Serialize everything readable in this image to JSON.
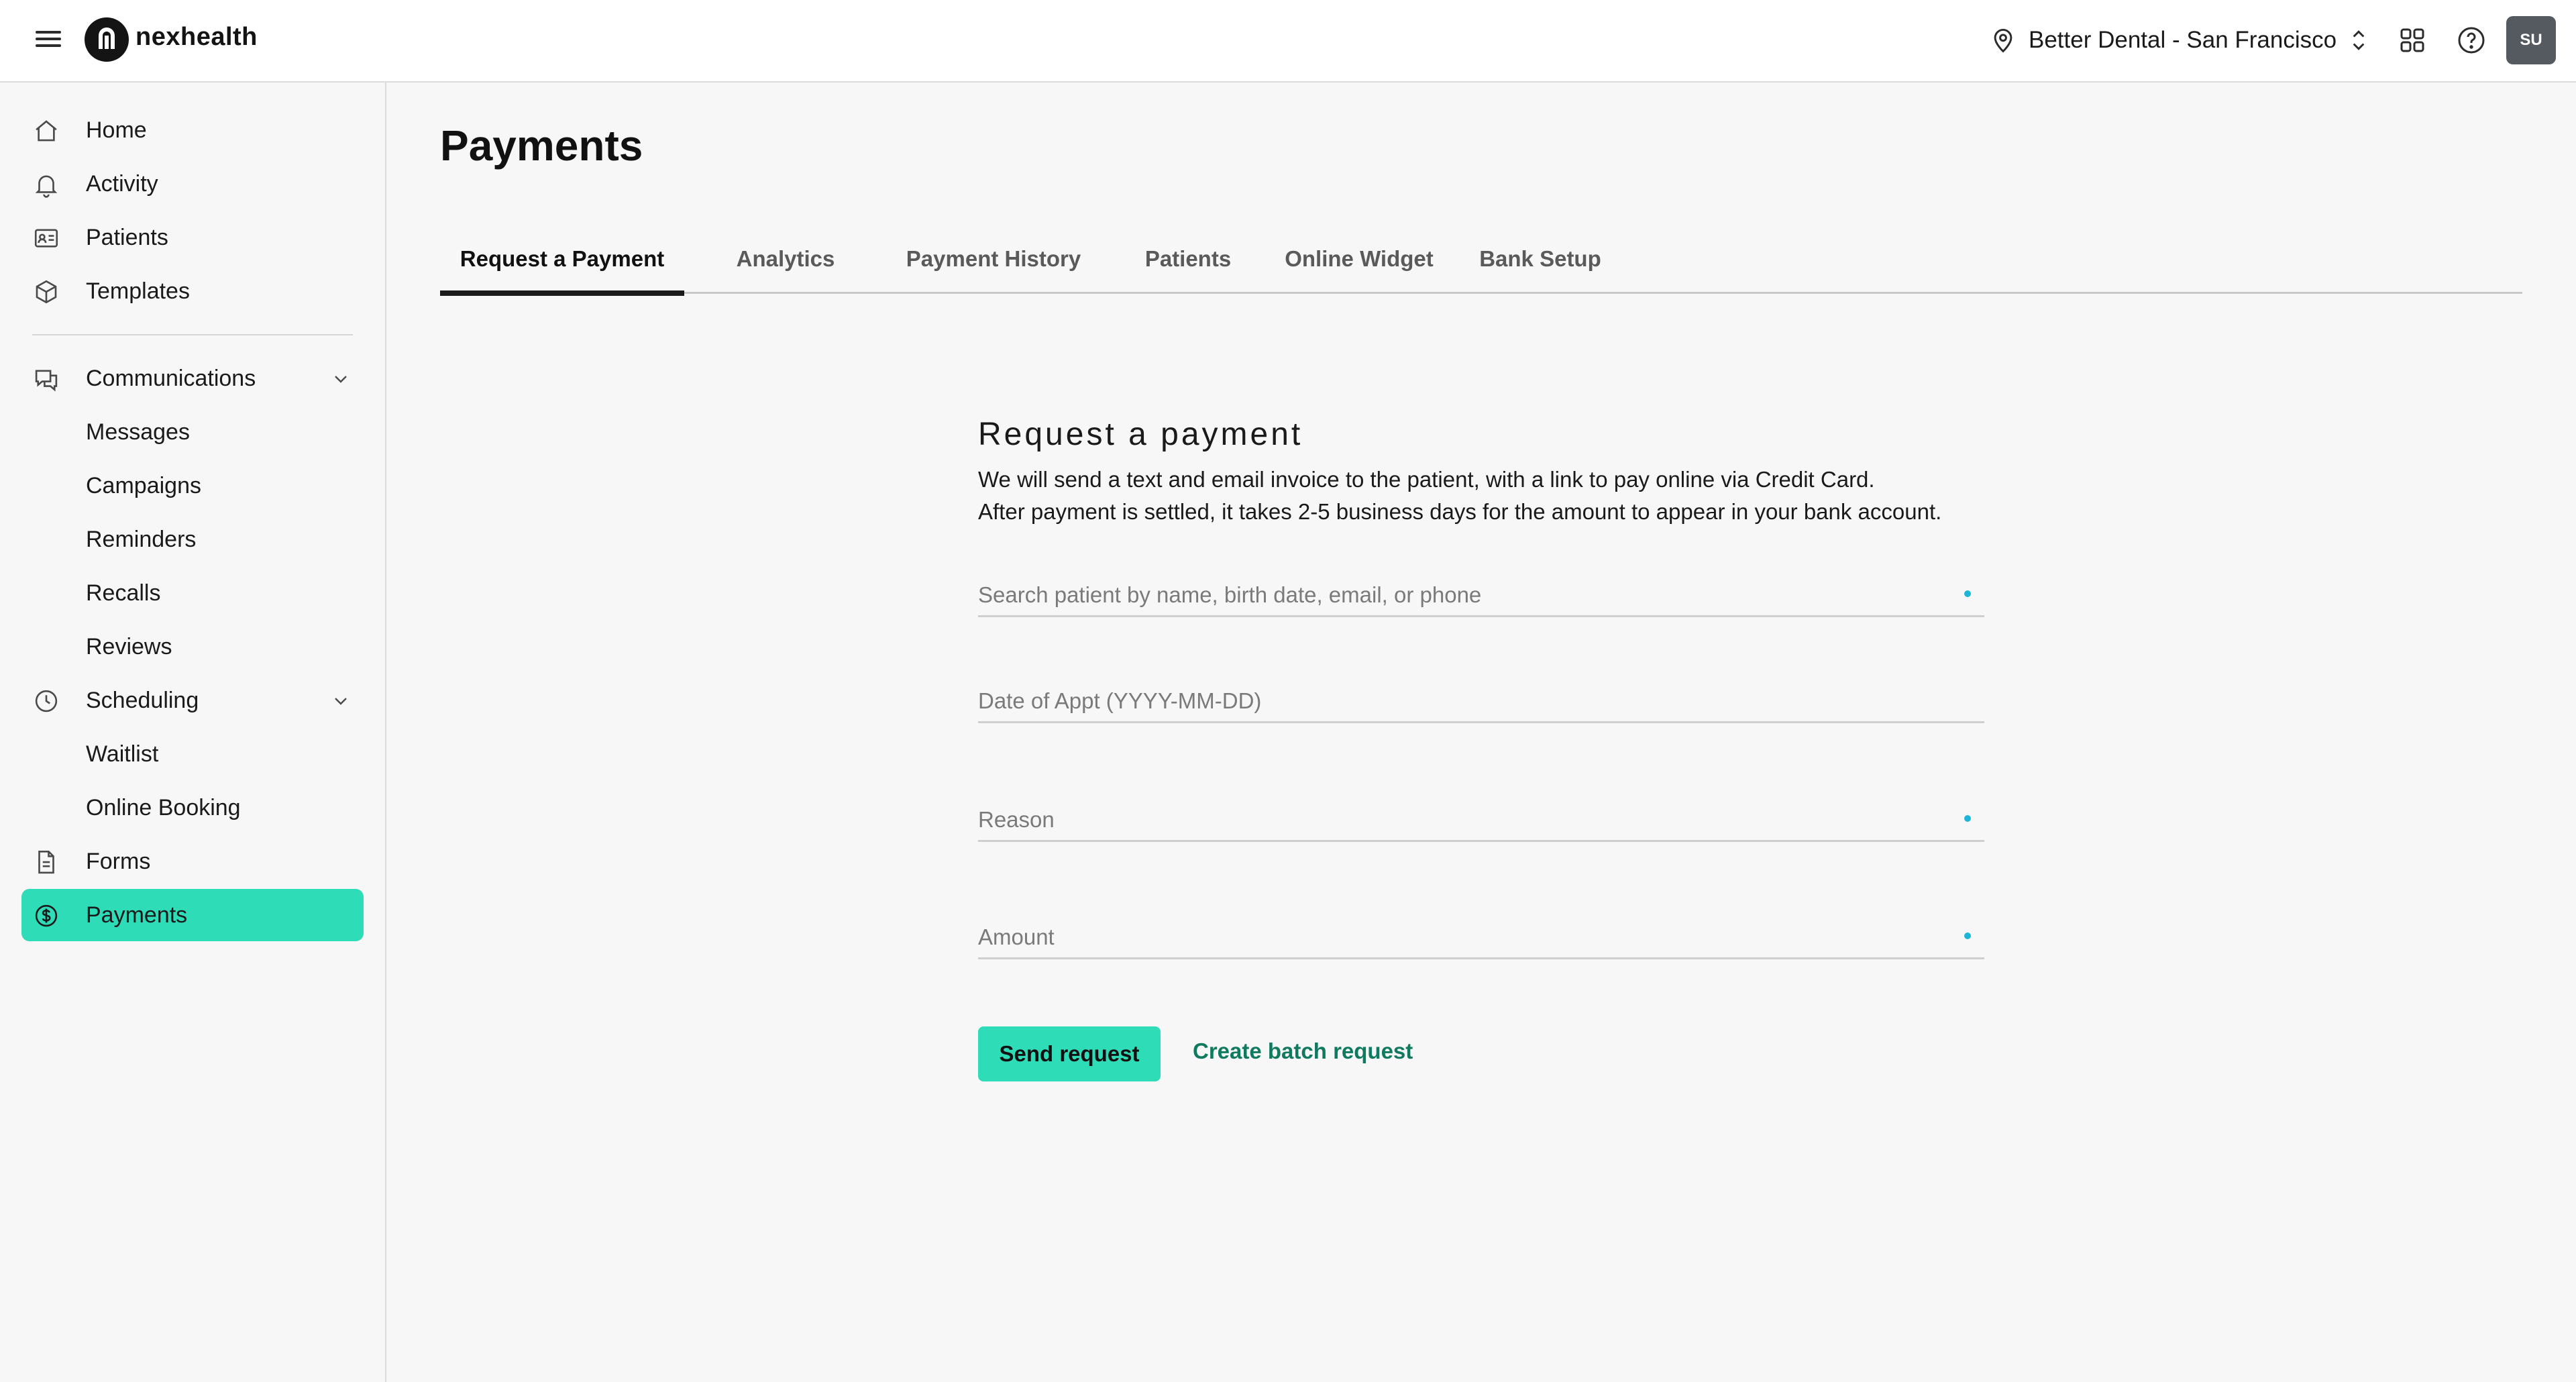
{
  "app": {
    "brand": "nexhealth"
  },
  "header": {
    "location": "Better Dental - San Francisco",
    "avatar_initials": "SU"
  },
  "sidebar": {
    "items": [
      {
        "label": "Home",
        "icon": "home-icon"
      },
      {
        "label": "Activity",
        "icon": "bell-icon"
      },
      {
        "label": "Patients",
        "icon": "id-card-icon"
      },
      {
        "label": "Templates",
        "icon": "cube-icon"
      },
      {
        "label": "Communications",
        "icon": "chat-icon",
        "expanded": true
      },
      {
        "label": "Messages"
      },
      {
        "label": "Campaigns"
      },
      {
        "label": "Reminders"
      },
      {
        "label": "Recalls"
      },
      {
        "label": "Reviews"
      },
      {
        "label": "Scheduling",
        "icon": "clock-icon",
        "expanded": true
      },
      {
        "label": "Waitlist"
      },
      {
        "label": "Online Booking"
      },
      {
        "label": "Forms",
        "icon": "document-icon"
      },
      {
        "label": "Payments",
        "icon": "dollar-icon",
        "active": true
      }
    ]
  },
  "page": {
    "title": "Payments",
    "tabs": [
      {
        "label": "Request a Payment",
        "active": true
      },
      {
        "label": "Analytics"
      },
      {
        "label": "Payment History"
      },
      {
        "label": "Patients"
      },
      {
        "label": "Online Widget"
      },
      {
        "label": "Bank Setup"
      }
    ]
  },
  "form": {
    "heading": "Request a payment",
    "description_line1": "We will send a text and email invoice to the patient, with a link to pay online via Credit Card.",
    "description_line2": "After payment is settled, it takes 2-5 business days for the amount to appear in your bank account.",
    "search_placeholder": "Search patient by name, birth date, email, or phone",
    "date_placeholder": "Date of Appt (YYYY-MM-DD)",
    "reason_placeholder": "Reason",
    "amount_placeholder": "Amount",
    "send_label": "Send request",
    "batch_label": "Create batch request"
  },
  "colors": {
    "accent": "#2fdcb8",
    "link": "#0f7a5f",
    "required_dot": "#1eb6d8"
  }
}
